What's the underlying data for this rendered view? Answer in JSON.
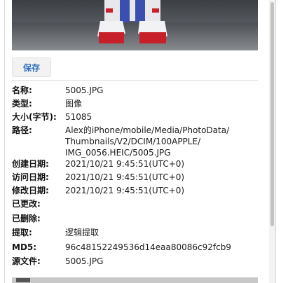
{
  "toolbar": {
    "save_label": "保存"
  },
  "properties": [
    {
      "key": "名称:",
      "value": "5005.JPG"
    },
    {
      "key": "类型:",
      "value": "图像"
    },
    {
      "key": "大小(字节):",
      "value": "51085"
    },
    {
      "key": "路径:",
      "value": "Alex的iPhone/mobile/Media/PhotoData/\nThumbnails/V2/DCIM/100APPLE/\nIMG_0056.HEIC/5005.JPG"
    },
    {
      "key": "创建日期:",
      "value": "2021/10/21 9:45:51(UTC+0)"
    },
    {
      "key": "访问日期:",
      "value": "2021/10/21 9:45:51(UTC+0)"
    },
    {
      "key": "修改日期:",
      "value": "2021/10/21 9:45:51(UTC+0)"
    },
    {
      "key": "已更改:",
      "value": ""
    },
    {
      "key": "已删除:",
      "value": ""
    },
    {
      "key": "提取:",
      "value": "逻辑提取"
    },
    {
      "key": "MD5:",
      "value": "96c48152249536d14eaa80086c92fcb9"
    },
    {
      "key": "源文件:",
      "value": "5005.JPG"
    }
  ]
}
